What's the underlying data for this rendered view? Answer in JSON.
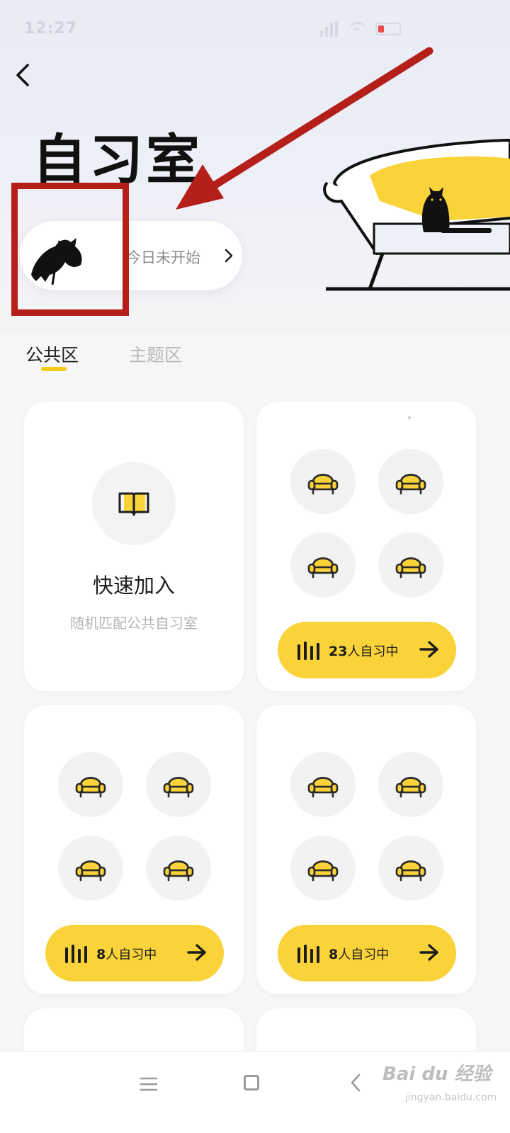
{
  "status_bar": {
    "time": "12:27"
  },
  "header": {
    "title": "自习室",
    "user_status": "今日未开始"
  },
  "tabs": [
    {
      "label": "公共区",
      "active": true
    },
    {
      "label": "主题区",
      "active": false
    }
  ],
  "quick_join": {
    "title": "快速加入",
    "subtitle": "随机匹配公共自习室"
  },
  "rooms": [
    {
      "count": "23",
      "suffix": "人自习中"
    },
    {
      "count": "8",
      "suffix": "人自习中"
    },
    {
      "count": "8",
      "suffix": "人自习中"
    }
  ],
  "watermark": {
    "text": "Bai du 经验",
    "url": "jingyan.baidu.com"
  },
  "colors": {
    "accent_yellow": "#f9d339",
    "annotation_red": "#b51f1a",
    "seat_yellow": "#f5cc1c"
  },
  "icons": {
    "back": "chevron-left-icon",
    "seat": "armchair-icon",
    "book": "open-book-icon",
    "bars": "audio-bars-icon",
    "arrow": "arrow-right-icon"
  }
}
